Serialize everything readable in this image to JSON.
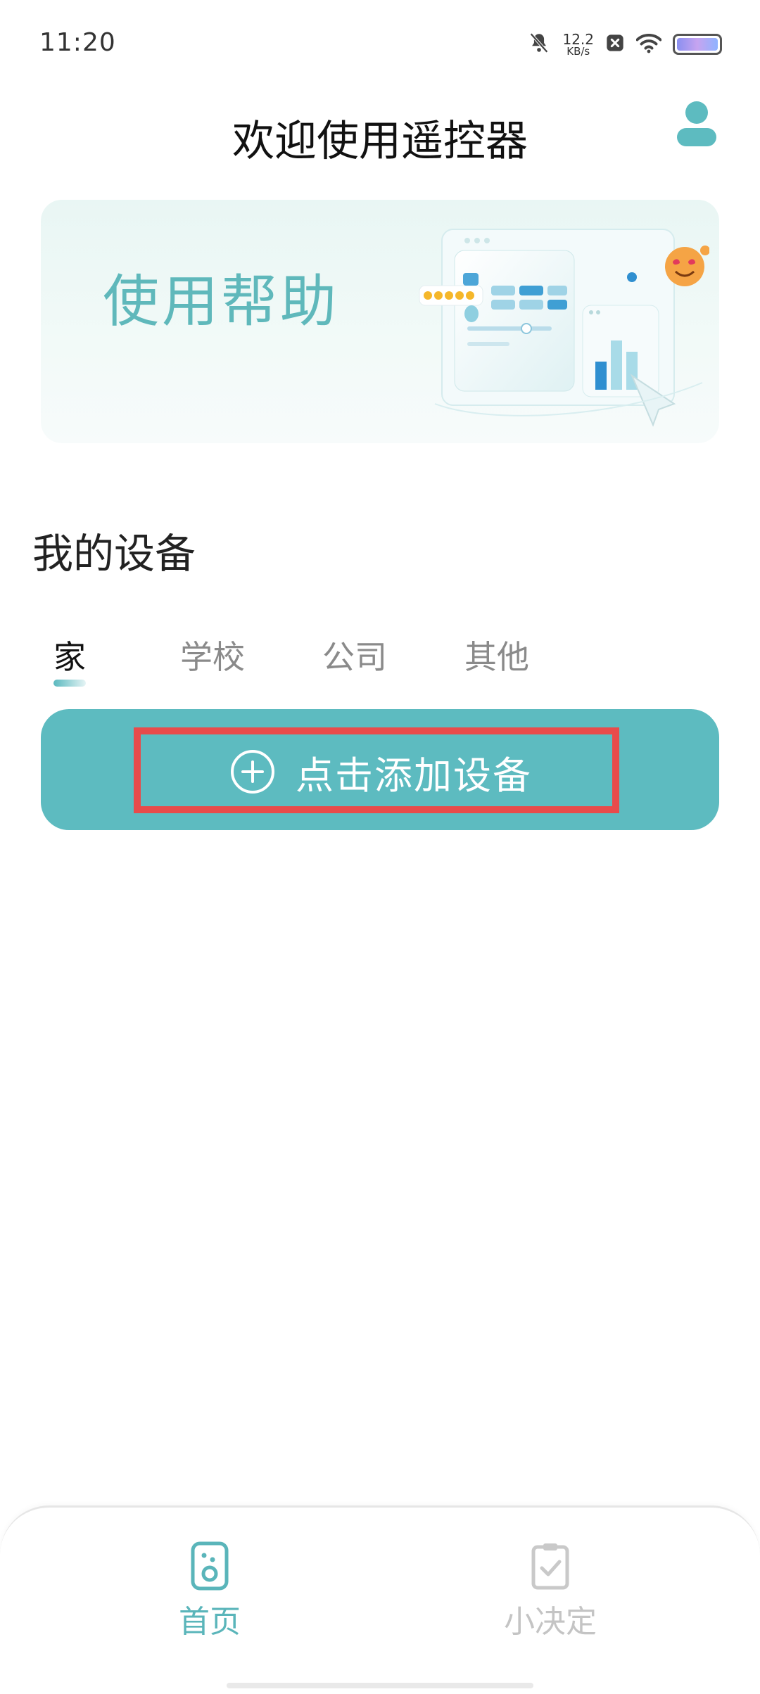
{
  "status_bar": {
    "time": "11:20",
    "net_speed_value": "12.2",
    "net_speed_unit": "KB/s",
    "icons": [
      "mute-bell-icon",
      "close-box-icon",
      "wifi-icon",
      "battery-icon"
    ]
  },
  "header": {
    "title": "欢迎使用遥控器",
    "profile_icon": "user-icon"
  },
  "banner": {
    "title": "使用帮助"
  },
  "devices": {
    "section_title": "我的设备",
    "tabs": [
      {
        "label": "家",
        "active": true
      },
      {
        "label": "学校",
        "active": false
      },
      {
        "label": "公司",
        "active": false
      },
      {
        "label": "其他",
        "active": false
      }
    ],
    "add_button_label": "点击添加设备"
  },
  "bottom_nav": {
    "items": [
      {
        "label": "首页",
        "icon": "remote-icon",
        "active": true
      },
      {
        "label": "小决定",
        "icon": "clipboard-check-icon",
        "active": false
      }
    ]
  },
  "colors": {
    "accent": "#5dbbc0",
    "banner_text": "#5fb8bb",
    "highlight_box": "#e84b4b",
    "inactive_tab": "#8a8a8a"
  }
}
